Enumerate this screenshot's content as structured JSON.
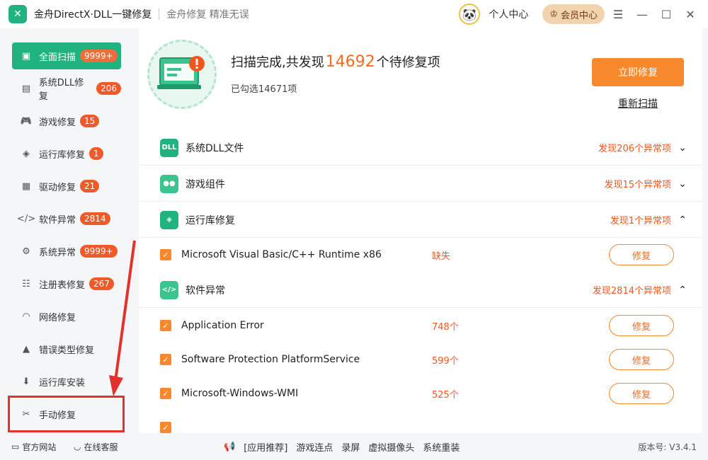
{
  "app": {
    "title": "金舟DirectX·DLL一键修复",
    "slogan": "金舟修复 精准无误"
  },
  "header": {
    "personal_center": "个人中心",
    "vip_center": "会员中心"
  },
  "sidebar": {
    "items": [
      {
        "label": "全面扫描",
        "badge": "9999+",
        "icon": "scan-icon"
      },
      {
        "label": "系统DLL修复",
        "badge": "206",
        "icon": "dll-icon"
      },
      {
        "label": "游戏修复",
        "badge": "15",
        "icon": "gamepad-icon"
      },
      {
        "label": "运行库修复",
        "badge": "1",
        "icon": "runtime-icon"
      },
      {
        "label": "驱动修复",
        "badge": "21",
        "icon": "driver-icon"
      },
      {
        "label": "软件异常",
        "badge": "2814",
        "icon": "code-icon"
      },
      {
        "label": "系统异常",
        "badge": "9999+",
        "icon": "gear-icon"
      },
      {
        "label": "注册表修复",
        "badge": "267",
        "icon": "registry-icon"
      },
      {
        "label": "网络修复",
        "badge": "",
        "icon": "wifi-icon"
      },
      {
        "label": "错误类型修复",
        "badge": "",
        "icon": "warning-icon"
      },
      {
        "label": "运行库安装",
        "badge": "",
        "icon": "install-icon"
      },
      {
        "label": "手动修复",
        "badge": "",
        "icon": "wrench-icon"
      }
    ]
  },
  "scan": {
    "title_prefix": "扫描完成,共发现",
    "count": "14692",
    "title_suffix": "个待修复项",
    "selected": "已勾选14671项",
    "repair_now": "立即修复",
    "rescan": "重新扫描"
  },
  "categories": {
    "dll": {
      "label": "系统DLL文件",
      "status": "发现206个异常项",
      "icon_text": "DLL"
    },
    "game": {
      "label": "游戏组件",
      "status": "发现15个异常项"
    },
    "runtime": {
      "label": "运行库修复",
      "status": "发现1个异常项"
    },
    "software": {
      "label": "软件异常",
      "status": "发现2814个异常项"
    }
  },
  "items": [
    {
      "name": "Microsoft Visual Basic/C++ Runtime x86",
      "status": "缺失",
      "action": "修复"
    },
    {
      "name": "Application Error",
      "status": "748个",
      "action": "修复"
    },
    {
      "name": "Software Protection PlatformService",
      "status": "599个",
      "action": "修复"
    },
    {
      "name": "Microsoft-Windows-WMI",
      "status": "525个",
      "action": "修复"
    }
  ],
  "footer": {
    "website": "官方网站",
    "support": "在线客服",
    "app_recommend": "[应用推荐]",
    "links": [
      "游戏连点",
      "录屏",
      "虚拟摄像头",
      "系统重装"
    ],
    "version": "版本号: V3.4.1"
  },
  "colors": {
    "accent_green": "#20b37f",
    "accent_orange": "#f7892c",
    "alert_red": "#f0561e",
    "highlight_box": "#e3322d"
  }
}
